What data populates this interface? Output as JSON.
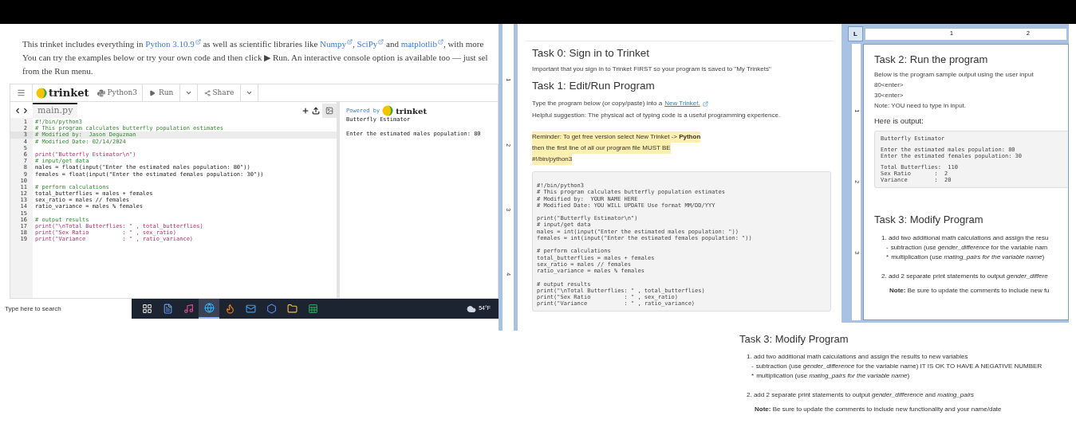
{
  "trinket": {
    "intro": [
      {
        "segments": [
          {
            "text": "This trinket includes everything in ",
            "kind": "text"
          },
          {
            "text": "Python 3.10.9",
            "kind": "link"
          },
          {
            "text": " as well as scientific libraries like ",
            "kind": "text"
          },
          {
            "text": "Numpy",
            "kind": "link"
          },
          {
            "text": ", ",
            "kind": "text"
          },
          {
            "text": "SciPy",
            "kind": "link"
          },
          {
            "text": " and ",
            "kind": "text"
          },
          {
            "text": "matplotlib",
            "kind": "link"
          },
          {
            "text": ", with more",
            "kind": "text"
          }
        ]
      },
      {
        "segments": [
          {
            "kind": "text",
            "text": "You can try the examples below or try your own code and then click ▶ Run. An interactive console option is available too — just sel"
          }
        ]
      },
      {
        "segments": [
          {
            "kind": "text",
            "text": "from the Run menu."
          }
        ]
      }
    ],
    "toolbar": {
      "logo": "trinket",
      "language": "Python3",
      "run": "Run",
      "share": "Share"
    },
    "file_tab": {
      "label": "main.py",
      "selected": true
    },
    "code": [
      {
        "number": "1",
        "text": "#!/bin/python3",
        "kind": "comment",
        "selected": false
      },
      {
        "number": "2",
        "text": "# This program calculates butterfly population estimates",
        "kind": "comment",
        "selected": false
      },
      {
        "number": "3",
        "text": "# Modified by:  Jason Deguzman",
        "kind": "comment",
        "selected": true
      },
      {
        "number": "4",
        "text": "# Modified Date: 02/14/2024",
        "kind": "comment",
        "selected": false
      },
      {
        "number": "5",
        "selected": false
      },
      {
        "number": "6",
        "text": "print(\"Butterfly Estimator\\n\")",
        "kind": "print",
        "selected": false
      },
      {
        "number": "7",
        "text": "# input/get data",
        "kind": "comment",
        "selected": false
      },
      {
        "number": "8",
        "text": "males = float(input(\"Enter the estimated males population: 80\"))",
        "kind": "code",
        "selected": false
      },
      {
        "number": "9",
        "text": "females = float(input(\"Enter the estimated females population: 30\"))",
        "kind": "code",
        "selected": false
      },
      {
        "number": "10",
        "selected": false
      },
      {
        "number": "11",
        "text": "# perform calculations",
        "kind": "comment",
        "selected": false
      },
      {
        "number": "12",
        "text": "total_butterflies = males + females",
        "kind": "code",
        "selected": false
      },
      {
        "number": "13",
        "text": "sex_ratio = males // females",
        "kind": "code",
        "selected": false
      },
      {
        "number": "14",
        "text": "ratio_variance = males % females",
        "kind": "code",
        "selected": false
      },
      {
        "number": "15",
        "selected": false
      },
      {
        "number": "16",
        "text": "# output results",
        "kind": "comment",
        "selected": false
      },
      {
        "number": "17",
        "text": "print(\"\\nTotal Butterflies: \" , total_butterflies)",
        "kind": "print",
        "selected": false
      },
      {
        "number": "18",
        "text": "print(\"Sex Ratio          : \" , sex_ratio)",
        "kind": "print",
        "selected": false
      },
      {
        "number": "19",
        "text": "print(\"Variance           : \" , ratio_variance)",
        "kind": "print",
        "selected": false
      }
    ],
    "output": {
      "powered_by": "Powered by",
      "logo": "trinket",
      "title": "Butterfly Estimator",
      "prompt": "Enter the estimated males population: 80"
    }
  },
  "taskbar": {
    "search_placeholder": "Type here to search",
    "weather": "54°F",
    "apps": [
      {
        "kind": "task-view",
        "selected": false
      },
      {
        "kind": "document",
        "selected": false
      },
      {
        "kind": "music",
        "selected": false
      },
      {
        "kind": "browser",
        "selected": true
      },
      {
        "kind": "fox",
        "selected": false
      },
      {
        "kind": "mail",
        "selected": false
      },
      {
        "kind": "hexagon",
        "selected": false
      },
      {
        "kind": "folder",
        "selected": false
      },
      {
        "kind": "spreadsheet",
        "selected": false
      }
    ]
  },
  "doc_page_1": {
    "ruler_numbers": [
      "1",
      "2",
      "3",
      "4"
    ],
    "heading_0": "Task 0: Sign in to Trinket",
    "para_0": "Important that you sign in to Trinket FIRST so your program is saved to \"My Trinkets\"",
    "heading_1": "Task 1: Edit/Run Program",
    "para_1": "Type the program below (or copy/paste) into a",
    "link": "New Trinket.",
    "para_2": "Helpful suggestion: The physical act of typing code is a useful programming experience.",
    "reminder": [
      "Reminder: To get free version select New Trinket -> **Python**",
      "then the first line of all our program file MUST BE",
      "#!/bin/python3"
    ],
    "code_groups": [
      [
        "#!/bin/python3",
        "# This program calculates butterfly population estimates",
        "# Modified by:  YOUR NAME HERE",
        "# Modified Date: YOU WILL UPDATE Use format MM/DD/YYY"
      ],
      [
        "print(\"Butterfly Estimator\\n\")",
        "# input/get data",
        "males = int(input(\"Enter the estimated males population: \"))",
        "females = int(input(\"Enter the estimated females population: \"))"
      ],
      [
        "# perform calculations",
        "total_butterflies = males + females",
        "sex_ratio = males // females",
        "ratio_variance = males % females"
      ],
      [
        "# output results",
        "print(\"\\nTotal Butterflies: \" , total_butterflies)",
        "print(\"Sex Ratio          : \" , sex_ratio)",
        "print(\"Variance           : \" , ratio_variance)"
      ]
    ]
  },
  "doc_page_2": {
    "tab_stop": "L",
    "top_ruler": [
      "1",
      "2"
    ],
    "side_ruler": [
      "1",
      "2",
      "3"
    ],
    "heading_2": "Task 2: Run the program",
    "task2_lines": [
      "Below is the program sample output using the user input",
      "80<enter>",
      "30<enter>",
      "Note: YOU need to type in input."
    ],
    "output_label": "Here is output:",
    "output_groups": [
      [
        "Butterfly Estimator"
      ],
      [
        "Enter the estimated males population: 80",
        "Enter the estimated females population: 30"
      ],
      [
        "Total Butterflies:  110",
        "Sex Ratio       :  2",
        "Variance        :  20"
      ]
    ],
    "task3": {
      "heading": "Task 3: Modify Program",
      "item_1": "1. add two additional math calculations and assign the resu",
      "sub_items": [
        {
          "bullet": "-",
          "text": "subtraction (use *gender_difference* for the variable nam"
        },
        {
          "bullet": "*",
          "text": "multiplication (use *mating_pairs for the variable name*)"
        }
      ],
      "item_2": "2. add 2 separate print statements to output *gender_differe*",
      "note": "**Note:** Be sure to update the comments to include new fu"
    }
  },
  "task3_snippet": {
    "heading": "Task 3: Modify Program",
    "item_1": "1. add two additional math calculations and assign the results to new variables",
    "sub_items": [
      {
        "bullet": "-",
        "text": "subtraction (use *gender_difference* for the variable name) IT IS OK TO HAVE A NEGATIVE NUMBER"
      },
      {
        "bullet": "*",
        "text": "multiplication (use *mating_pairs for the variable name*)"
      }
    ],
    "item_2": "2. add 2 separate print statements to output *gender_difference* and *mating_pairs*",
    "note": "**Note:** Be sure to update the comments to include new functionality and your name/date"
  }
}
